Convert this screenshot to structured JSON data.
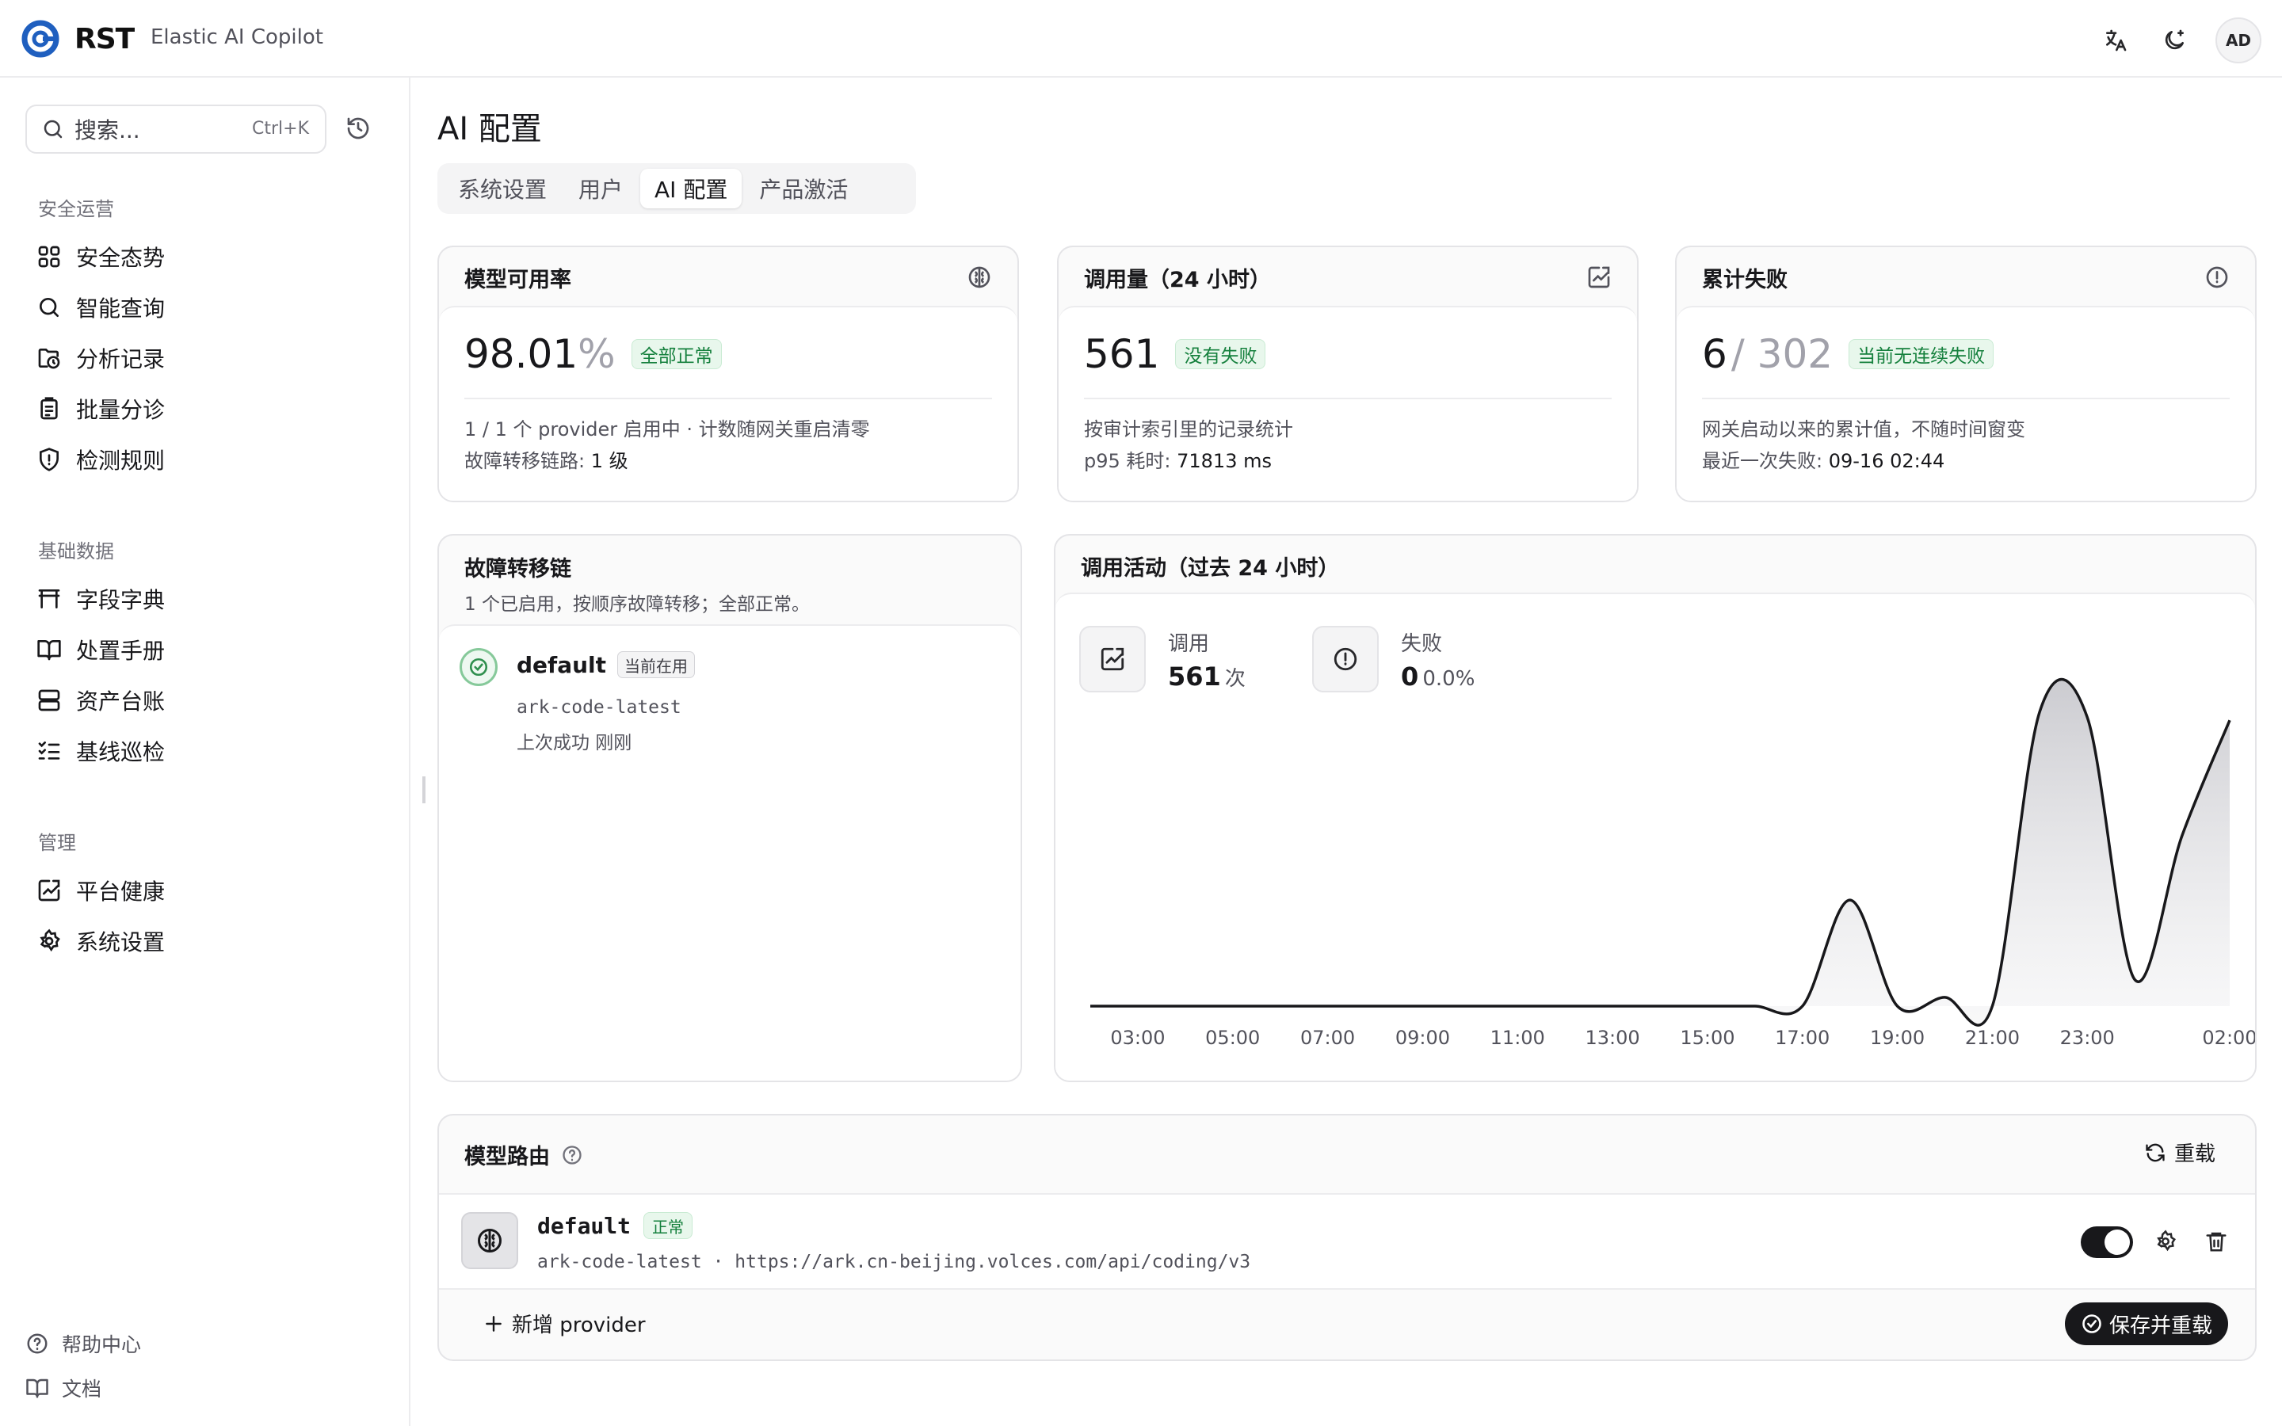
{
  "app": {
    "brand": "RST",
    "subtitle": "Elastic AI Copilot",
    "avatar": "AD"
  },
  "sidebar": {
    "search_placeholder": "搜索...",
    "search_shortcut": "Ctrl+K",
    "groups": [
      {
        "title": "安全运营",
        "items": [
          "安全态势",
          "智能查询",
          "分析记录",
          "批量分诊",
          "检测规则"
        ]
      },
      {
        "title": "基础数据",
        "items": [
          "字段字典",
          "处置手册",
          "资产台账",
          "基线巡检"
        ]
      },
      {
        "title": "管理",
        "items": [
          "平台健康",
          "系统设置"
        ]
      }
    ],
    "footer": [
      "帮助中心",
      "文档"
    ]
  },
  "page": {
    "title": "AI 配置",
    "tabs": [
      "系统设置",
      "用户",
      "AI 配置",
      "产品激活"
    ],
    "active_tab": "AI 配置"
  },
  "cards": {
    "availability": {
      "title": "模型可用率",
      "value": "98.01",
      "unit": "%",
      "badge": "全部正常",
      "line1": "1 / 1 个 provider 启用中 · 计数随网关重启清零",
      "line2_label": "故障转移链路: ",
      "line2_value": "1 级"
    },
    "calls": {
      "title": "调用量（24 小时）",
      "value": "561",
      "badge": "没有失败",
      "line1": "按审计索引里的记录统计",
      "line2_label": "p95 耗时: ",
      "line2_value": "71813 ms"
    },
    "failures": {
      "title": "累计失败",
      "value": "6",
      "total": "/ 302",
      "badge": "当前无连续失败",
      "line1": "网关启动以来的累计值，不随时间窗变",
      "line2_label": "最近一次失败: ",
      "line2_value": "09-16 02:44"
    }
  },
  "failover": {
    "title": "故障转移链",
    "subtitle": "1 个已启用，按顺序故障转移；全部正常。",
    "item": {
      "name": "default",
      "badge": "当前在用",
      "model": "ark-code-latest",
      "status": "上次成功 刚刚"
    }
  },
  "activity": {
    "title": "调用活动（过去 24 小时）",
    "calls_label": "调用",
    "calls_value": "561",
    "calls_unit": "次",
    "fail_label": "失败",
    "fail_value": "0",
    "fail_pct": "0.0%"
  },
  "chart_data": {
    "type": "area",
    "title": "",
    "xlabel": "",
    "ylabel": "",
    "x_ticks": [
      "03:00",
      "05:00",
      "07:00",
      "09:00",
      "11:00",
      "13:00",
      "15:00",
      "17:00",
      "19:00",
      "21:00",
      "23:00",
      "02:00"
    ],
    "x": [
      "02:00",
      "03:00",
      "04:00",
      "05:00",
      "06:00",
      "07:00",
      "08:00",
      "09:00",
      "10:00",
      "11:00",
      "12:00",
      "13:00",
      "14:00",
      "15:00",
      "16:00",
      "17:00",
      "18:00",
      "19:00",
      "20:00",
      "21:00",
      "22:00",
      "23:00",
      "00:00",
      "01:00",
      "02:00"
    ],
    "values": [
      0,
      0,
      0,
      0,
      0,
      0,
      0,
      0,
      0,
      0,
      0,
      0,
      0,
      0,
      0,
      0,
      36,
      0,
      3,
      0,
      100,
      98,
      9,
      58,
      97
    ],
    "grid": false,
    "legend": "none"
  },
  "routing": {
    "title": "模型路由",
    "reload_label": "重载",
    "provider": {
      "name": "default",
      "badge": "正常",
      "model": "ark-code-latest",
      "separator": "·",
      "endpoint": "https://ark.cn-beijing.volces.com/api/coding/v3",
      "enabled": true
    },
    "add_label": "新增 provider",
    "save_label": "保存并重载"
  }
}
